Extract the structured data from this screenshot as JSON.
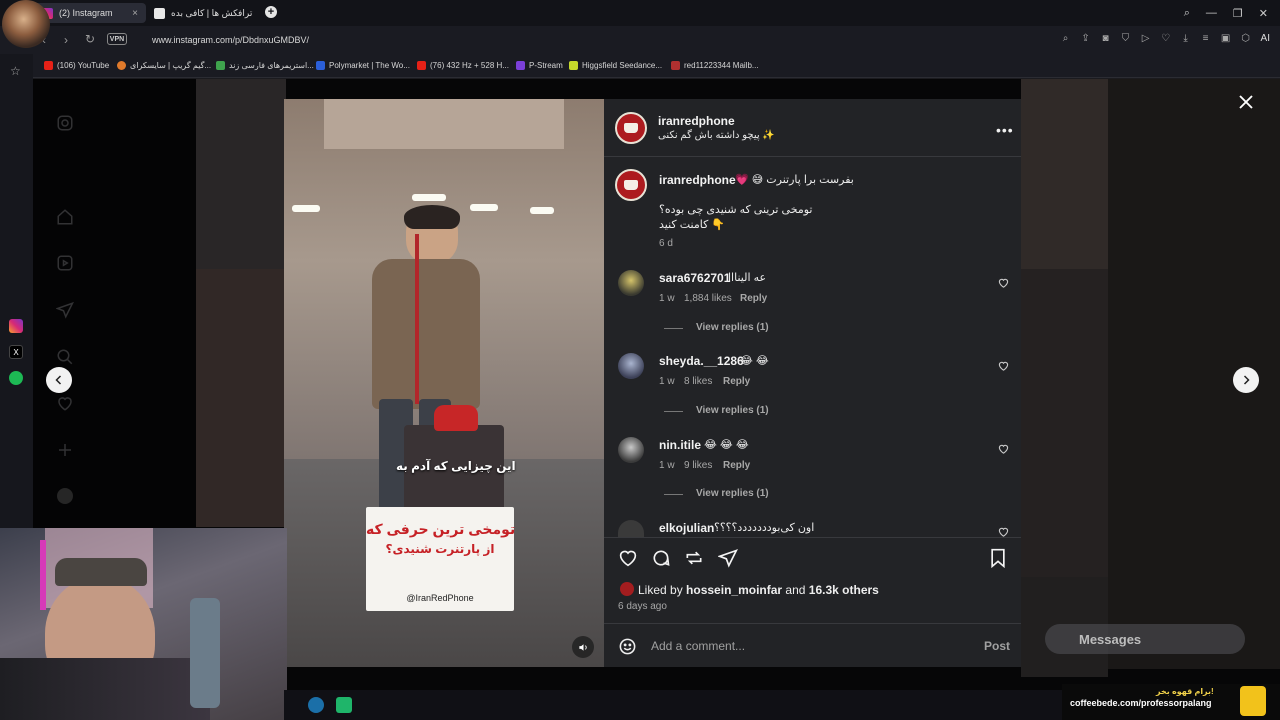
{
  "browser": {
    "tabs": [
      {
        "label": "(2) Instagram",
        "active": true
      },
      {
        "label": "ترافکش ها | کافی بده",
        "active": false
      }
    ],
    "vpn_label": "VPN",
    "url": "www.instagram.com/p/DbdnxuGMDBV/",
    "bookmarks": [
      {
        "label": "(106) YouTube",
        "color": "#e62117"
      },
      {
        "label": "گیم گریپ | سایسکرای...",
        "color": "#e07a2b"
      },
      {
        "label": "استریمرهای فارسی زند...",
        "color": "#3fa34d"
      },
      {
        "label": "Polymarket | The Wo...",
        "color": "#2b5fd9"
      },
      {
        "label": "(76) 432 Hz + 528 H...",
        "color": "#e62117"
      },
      {
        "label": "P-Stream",
        "color": "#7b3fd9"
      },
      {
        "label": "Higgsfield Seedance...",
        "color": "#c6d92b"
      },
      {
        "label": "red11223344 Mailb...",
        "color": "#b03030"
      }
    ],
    "ai_label": "AI"
  },
  "post": {
    "author": "iranredphone",
    "subtitle": "پیچو داشته باش گم نکنی ✨",
    "caption_author": "iranredphone",
    "caption_line1": "💗 😅 بفرست برا پارتنرت",
    "caption_line2": "تومخی ترینی که شنیدی چی بوده؟",
    "caption_line3": "کامنت کنید 👇",
    "caption_time": "6 d",
    "media_overlay_text": "این چیزایی که آدم به",
    "media_card_line1": "تومخی ترین حرفی که",
    "media_card_line2": "از پارتنرت شنیدی؟",
    "media_card_handle": "@IranRedPhone",
    "liked_by_prefix": "Liked by",
    "liked_by_user": "hossein_moinfar",
    "liked_by_and": "and",
    "liked_by_others": "16.3k others",
    "date": "6 days ago",
    "add_comment_placeholder": "Add a comment...",
    "post_label": "Post"
  },
  "comments": [
    {
      "user": "sara6762701",
      "text": "عه الینااا",
      "time": "1 w",
      "likes": "1,884 likes",
      "reply": "Reply",
      "view_replies": "View replies (1)"
    },
    {
      "user": "sheyda.__1286",
      "text": "😂 😂",
      "time": "1 w",
      "likes": "8 likes",
      "reply": "Reply",
      "view_replies": "View replies (1)"
    },
    {
      "user": "nin.itile",
      "text": "😂 😂 😂",
      "time": "1 w",
      "likes": "9 likes",
      "reply": "Reply",
      "view_replies": "View replies (1)"
    },
    {
      "user": "elkojulian",
      "text": "اون کی‌بوددددددد؟؟؟؟"
    }
  ],
  "messages_label": "Messages",
  "promo": {
    "line1": "برام قهوه بخر!",
    "line2": "coffeebede.com/professorpalang"
  }
}
